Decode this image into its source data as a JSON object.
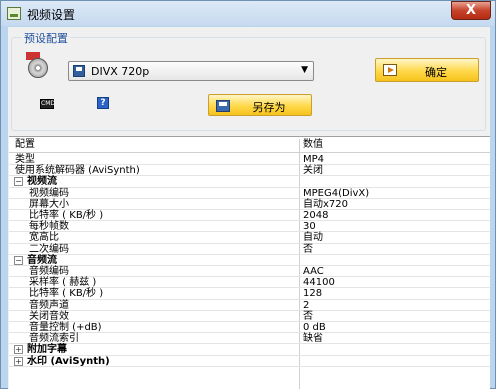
{
  "window": {
    "title": "视频设置",
    "close_label": "X"
  },
  "preset": {
    "group_label": "预设配置",
    "selected": "DIVX 720p",
    "ok_label": "确定",
    "save_as_label": "另存为",
    "small_icon_text": "CMD",
    "help_icon_text": "?"
  },
  "grid": {
    "header": {
      "col1": "配置",
      "col2": "数值"
    },
    "rows": [
      {
        "type": "prop",
        "indent": false,
        "name": "类型",
        "value": "MP4"
      },
      {
        "type": "prop",
        "indent": false,
        "name": "使用系统解码器 (AviSynth)",
        "value": "关闭"
      },
      {
        "type": "group",
        "toggle": "−",
        "name": "视频流",
        "value": ""
      },
      {
        "type": "prop",
        "indent": true,
        "name": "视频编码",
        "value": "MPEG4(DivX)"
      },
      {
        "type": "prop",
        "indent": true,
        "name": "屏幕大小",
        "value": "自动x720"
      },
      {
        "type": "prop",
        "indent": true,
        "name": "比特率 ( KB/秒 )",
        "value": "2048"
      },
      {
        "type": "prop",
        "indent": true,
        "name": "每秒帧数",
        "value": "30"
      },
      {
        "type": "prop",
        "indent": true,
        "name": "宽高比",
        "value": "自动"
      },
      {
        "type": "prop",
        "indent": true,
        "name": "二次编码",
        "value": "否"
      },
      {
        "type": "group",
        "toggle": "−",
        "name": "音频流",
        "value": ""
      },
      {
        "type": "prop",
        "indent": true,
        "name": "音频编码",
        "value": "AAC"
      },
      {
        "type": "prop",
        "indent": true,
        "name": "采样率 ( 赫兹 )",
        "value": "44100"
      },
      {
        "type": "prop",
        "indent": true,
        "name": "比特率 ( KB/秒 )",
        "value": "128"
      },
      {
        "type": "prop",
        "indent": true,
        "name": "音频声道",
        "value": "2"
      },
      {
        "type": "prop",
        "indent": true,
        "name": "关闭音效",
        "value": "否"
      },
      {
        "type": "prop",
        "indent": true,
        "name": "音量控制 (+dB)",
        "value": "0 dB"
      },
      {
        "type": "prop",
        "indent": true,
        "name": "音频流索引",
        "value": "缺省"
      },
      {
        "type": "group",
        "toggle": "+",
        "name": "附加字幕",
        "value": ""
      },
      {
        "type": "group",
        "toggle": "+",
        "name": "水印 (AviSynth)",
        "value": ""
      }
    ]
  }
}
